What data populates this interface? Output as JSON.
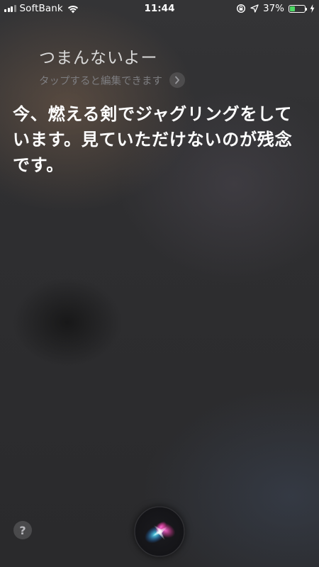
{
  "status_bar": {
    "carrier": "SoftBank",
    "time": "11:44",
    "battery_percent_label": "37%",
    "battery_level": 0.37,
    "battery_color": "#4cd964"
  },
  "siri": {
    "query": "つまんないよー",
    "edit_hint": "タップすると編集できます",
    "response": "今、燃える剣でジャグリングをしています。見ていただけないのが残念です。"
  },
  "bottom": {
    "help_label": "?"
  },
  "icons": {
    "signal": "signal-bars-icon",
    "wifi": "wifi-icon",
    "orientation_lock": "orientation-lock-icon",
    "location": "location-arrow-icon",
    "battery": "battery-icon",
    "charging": "charging-bolt-icon",
    "chevron": "chevron-right-icon",
    "siri": "siri-orb-icon"
  }
}
